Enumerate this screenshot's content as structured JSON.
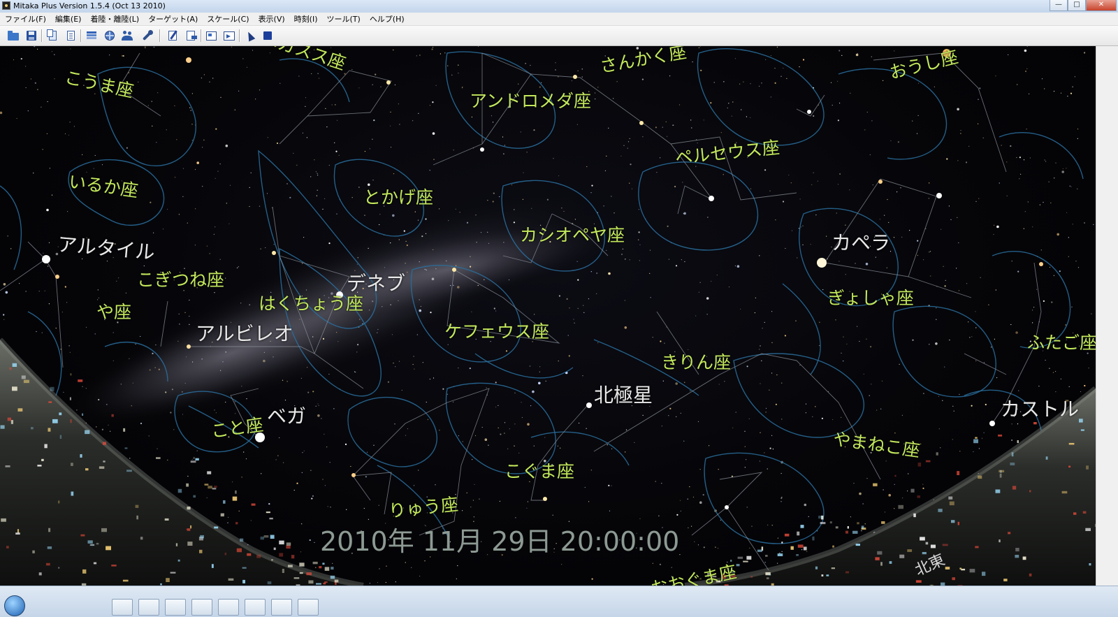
{
  "window": {
    "title": "Mitaka Plus Version 1.5.4 (Oct 13 2010)",
    "minimize_glyph": "—",
    "maximize_glyph": "□",
    "close_glyph": "✕"
  },
  "menu": [
    {
      "label": "ファイル(F)"
    },
    {
      "label": "編集(E)"
    },
    {
      "label": "着陸・離陸(L)"
    },
    {
      "label": "ターゲット(A)"
    },
    {
      "label": "スケール(C)"
    },
    {
      "label": "表示(V)"
    },
    {
      "label": "時刻(I)"
    },
    {
      "label": "ツール(T)"
    },
    {
      "label": "ヘルプ(H)"
    }
  ],
  "toolbar": [
    {
      "icon": "open-folder-icon"
    },
    {
      "icon": "save-icon"
    },
    {
      "icon": "copy-document-icon"
    },
    {
      "icon": "paste-document-icon"
    },
    {
      "icon": "layers-icon"
    },
    {
      "icon": "globe-icon"
    },
    {
      "icon": "people-icon"
    },
    {
      "icon": "wrench-icon"
    },
    {
      "icon": "edit-icon"
    },
    {
      "icon": "export-icon"
    },
    {
      "icon": "frame-icon"
    },
    {
      "icon": "movie-icon"
    },
    {
      "icon": "pointer-icon"
    },
    {
      "icon": "stop-icon"
    }
  ],
  "sky": {
    "constellations": [
      {
        "name": "こうま座"
      },
      {
        "name": "いるか座"
      },
      {
        "name": "こぎつね座"
      },
      {
        "name": "や座"
      },
      {
        "name": "はくちょう座"
      },
      {
        "name": "こと座"
      },
      {
        "name": "とかげ座"
      },
      {
        "name": "アンドロメダ座"
      },
      {
        "name": "さんかく座"
      },
      {
        "name": "おうし座"
      },
      {
        "name": "ペルセウス座"
      },
      {
        "name": "カシオペヤ座"
      },
      {
        "name": "ケフェウス座"
      },
      {
        "name": "ぎょしゃ座"
      },
      {
        "name": "きりん座"
      },
      {
        "name": "ふたご座"
      },
      {
        "name": "やまねこ座"
      },
      {
        "name": "こぐま座"
      },
      {
        "name": "りゅう座"
      },
      {
        "name": "ペガスス座"
      },
      {
        "name": "おおぐま座"
      }
    ],
    "stars": [
      {
        "name": "アルタイル"
      },
      {
        "name": "デネブ"
      },
      {
        "name": "アルビレオ"
      },
      {
        "name": "ベガ"
      },
      {
        "name": "カペラ"
      },
      {
        "name": "北極星"
      },
      {
        "name": "カストル"
      }
    ],
    "datetime": "2010年 11月 29日 20:00:00",
    "direction": "北東",
    "colors": {
      "constellation_label": "#c3e85c",
      "constellation_art": "#2a6f9e",
      "star_label": "#e8e8e8"
    }
  }
}
